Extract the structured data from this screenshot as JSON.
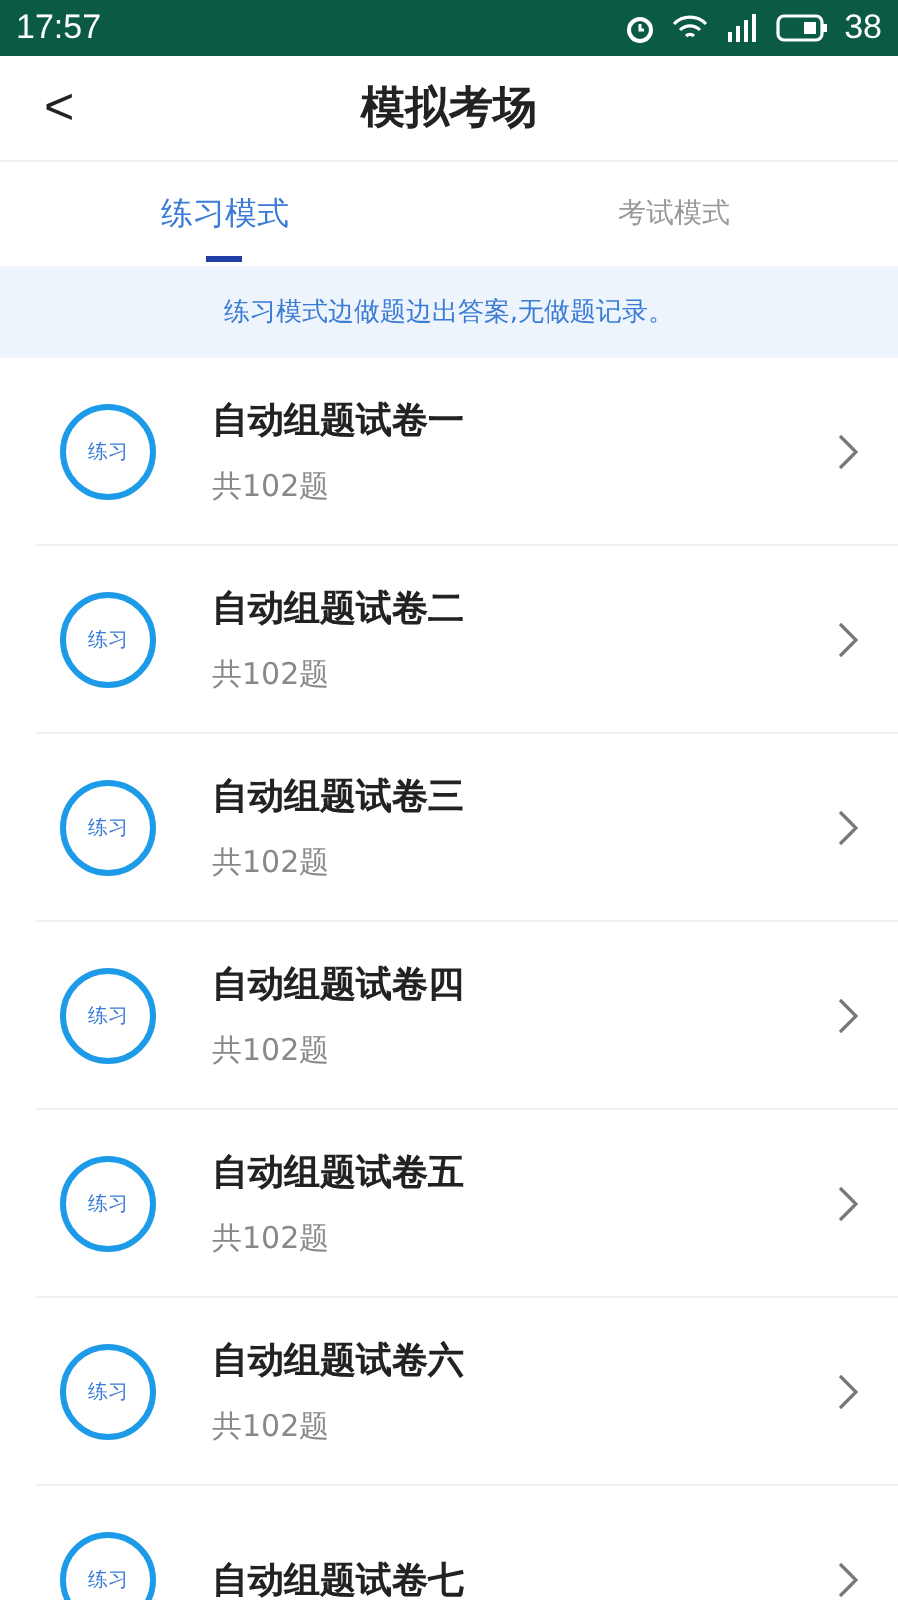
{
  "status_bar": {
    "time": "17:57",
    "battery": "38"
  },
  "header": {
    "back": "<",
    "title": "模拟考场"
  },
  "tabs": [
    {
      "label": "练习模式",
      "selected": true
    },
    {
      "label": "考试模式",
      "selected": false
    }
  ],
  "notice": "练习模式边做题边出答案,无做题记录。",
  "papers": [
    {
      "badge": "练习",
      "title": "自动组题试卷一",
      "count": "共102题"
    },
    {
      "badge": "练习",
      "title": "自动组题试卷二",
      "count": "共102题"
    },
    {
      "badge": "练习",
      "title": "自动组题试卷三",
      "count": "共102题"
    },
    {
      "badge": "练习",
      "title": "自动组题试卷四",
      "count": "共102题"
    },
    {
      "badge": "练习",
      "title": "自动组题试卷五",
      "count": "共102题"
    },
    {
      "badge": "练习",
      "title": "自动组题试卷六",
      "count": "共102题"
    },
    {
      "badge": "练习",
      "title": "自动组题试卷七"
    }
  ]
}
